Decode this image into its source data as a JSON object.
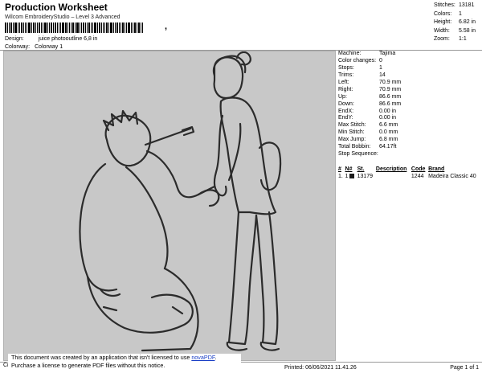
{
  "header": {
    "title": "Production Worksheet",
    "subtitle": "Wilcom EmbroideryStudio – Level 3 Advanced",
    "barcode_suffix": ","
  },
  "design_info": {
    "design_label": "Design:",
    "design_value": "juice photooutline 6,8 in",
    "colorway_label": "Colorway:",
    "colorway_value": "Colorway 1"
  },
  "summary": [
    {
      "label": "Stitches:",
      "value": "13181"
    },
    {
      "label": "Colors:",
      "value": "1"
    },
    {
      "label": "Height:",
      "value": "6.82 in"
    },
    {
      "label": "Width:",
      "value": "5.58 in"
    },
    {
      "label": "Zoom:",
      "value": "1:1"
    }
  ],
  "machine_params": [
    {
      "label": "Machine:",
      "value": "Tajima"
    },
    {
      "label": "Color changes:",
      "value": "0"
    },
    {
      "label": "Stops:",
      "value": "1"
    },
    {
      "label": "Trims:",
      "value": "14"
    },
    {
      "label": "Left:",
      "value": "70.9 mm"
    },
    {
      "label": "Right:",
      "value": "70.9 mm"
    },
    {
      "label": "Up:",
      "value": "86.6 mm"
    },
    {
      "label": "Down:",
      "value": "86.6 mm"
    },
    {
      "label": "EndX:",
      "value": "0.00 in"
    },
    {
      "label": "EndY:",
      "value": "0.00 in"
    },
    {
      "label": "Max Stitch:",
      "value": "6.6 mm"
    },
    {
      "label": "Min Stitch:",
      "value": "0.0 mm"
    },
    {
      "label": "Max Jump:",
      "value": "6.8 mm"
    },
    {
      "label": "Total Bobbin:",
      "value": "64.17ft"
    }
  ],
  "stop_sequence": {
    "title": "Stop Sequence:",
    "columns": [
      "#",
      "N#",
      "St.",
      "Description",
      "Code",
      "Brand"
    ],
    "rows": [
      {
        "num": "1.",
        "n": "1",
        "st": "13179",
        "description": "",
        "code": "1244",
        "brand": "Madeira Classic 40",
        "color": "#1a1a1a"
      }
    ]
  },
  "notice": {
    "line1_prefix": "This document was created by an application that isn't licensed to use ",
    "link_text": "novaPDF",
    "line1_suffix": ".",
    "line2": "Purchase a license to generate PDF files without this notice."
  },
  "footer": {
    "cr_text": "Cr",
    "printed": "Printed: 06/06/2021 11.41.26",
    "page": "Page 1 of 1"
  },
  "colors": {
    "design_background": "#c8c8c8",
    "outline": "#2b2b2b"
  }
}
